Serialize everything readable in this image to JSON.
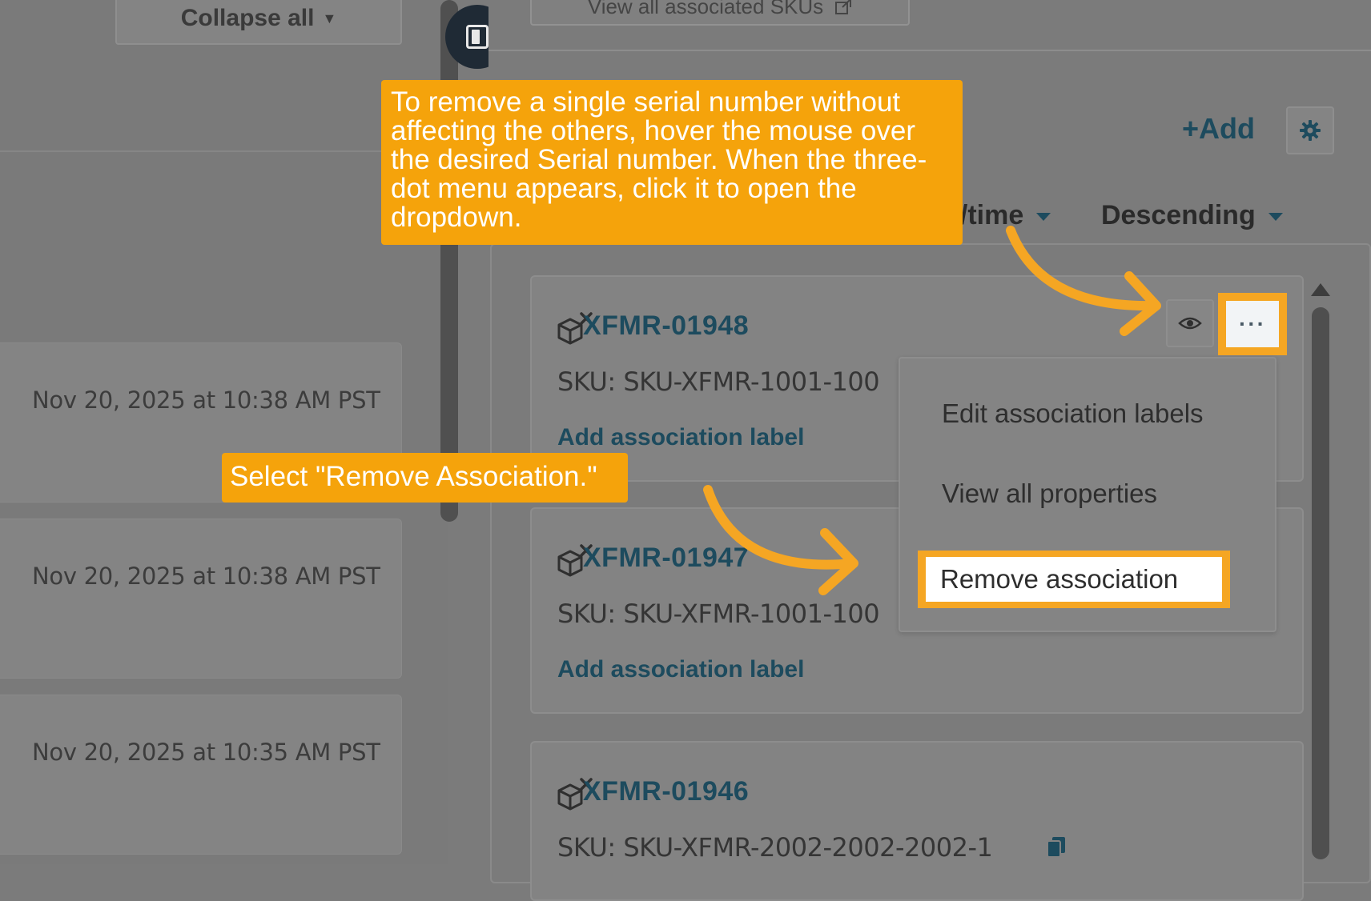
{
  "left": {
    "collapse_label": "Collapse all",
    "activity_dates": [
      "Nov 20, 2025 at 10:38 AM PST",
      "Nov 20, 2025 at 10:38 AM PST",
      "Nov 20, 2025 at 10:35 AM PST"
    ]
  },
  "right": {
    "view_skus_label": "View all associated SKUs",
    "add_label": "+Add",
    "sort_field": "e/time",
    "sort_order": "Descending",
    "serials": [
      {
        "title": "XFMR-01948",
        "sku": "SKU: SKU-XFMR-1001-100",
        "assoc_label": "Add association label"
      },
      {
        "title": "XFMR-01947",
        "sku": "SKU: SKU-XFMR-1001-100",
        "assoc_label": "Add association label"
      },
      {
        "title": "XFMR-01946",
        "sku": "SKU: SKU-XFMR-2002-2002-2002-1"
      }
    ],
    "more_label": "···",
    "menu": {
      "edit": "Edit association labels",
      "view": "View all properties",
      "remove": "Remove association"
    }
  },
  "overlay": {
    "callout_main": "To remove a single serial number without affecting the others, hover the mouse over the desired Serial number. When the three-dot menu appears, click it to open the dropdown.",
    "callout_select": "Select \"Remove Association.\""
  },
  "colors": {
    "callout": "#f5a30b",
    "link": "#1d4b5e",
    "highlight": "#f5a623"
  }
}
